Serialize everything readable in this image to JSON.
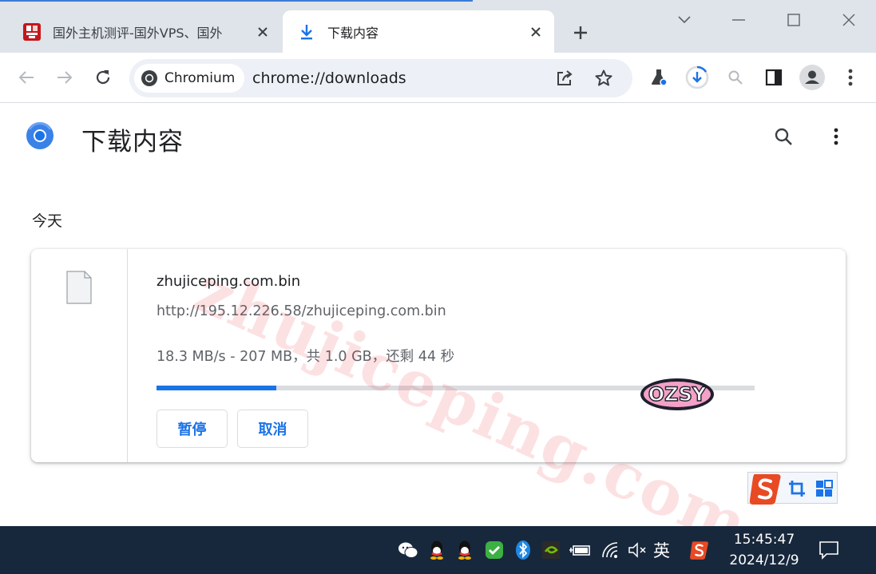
{
  "colors": {
    "accent": "#1a73e8",
    "tabstrip": "#dfe3ea",
    "taskbar": "#18283c",
    "watermark": "#eb4650"
  },
  "tabs": [
    {
      "title": "国外主机测评-国外VPS、国外",
      "icon": "site-favicon",
      "active": false
    },
    {
      "title": "下载内容",
      "icon": "download-icon",
      "active": true
    }
  ],
  "toolbar": {
    "chip_label": "Chromium",
    "url": "chrome://downloads"
  },
  "page": {
    "title": "下载内容",
    "section": "今天"
  },
  "download": {
    "filename": "zhujiceping.com.bin",
    "url": "http://195.12.226.58/zhujiceping.com.bin",
    "status": "18.3 MB/s - 207 MB，共 1.0 GB，还剩 44 秒",
    "progress_fraction": 0.2,
    "pause_label": "暂停",
    "cancel_label": "取消"
  },
  "overlay": {
    "watermark": "zhujiceping.com",
    "sticker": "OZSY"
  },
  "taskbar": {
    "ime_label": "英",
    "time": "15:45:47",
    "date": "2024/12/9"
  }
}
